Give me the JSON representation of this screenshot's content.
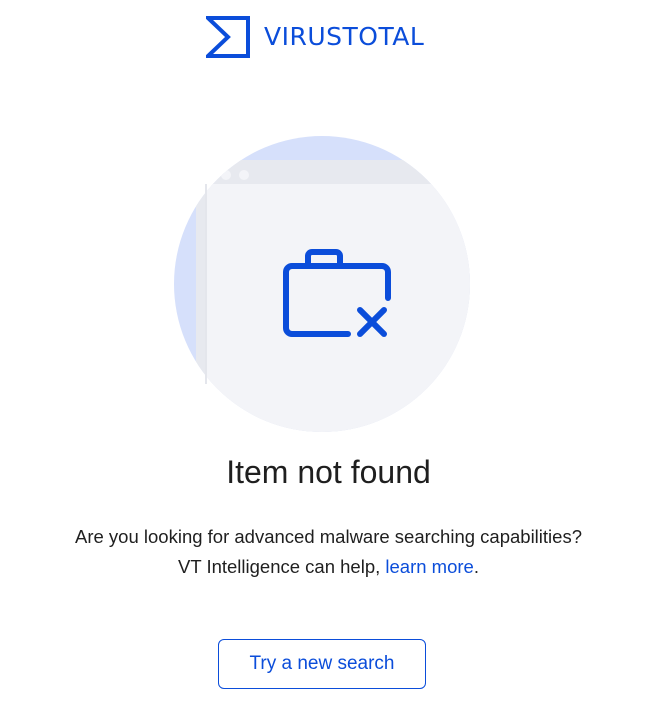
{
  "brand": {
    "name": "VIRUSTOTAL",
    "logo_icon": "virustotal-sigma-logo-icon",
    "color": "#0b4dda"
  },
  "illustration": {
    "icon": "folder-x-icon",
    "circle_color": "#f0f1f5",
    "accent_color": "#0b4dda"
  },
  "message": {
    "title": "Item not found",
    "line1": "Are you looking for advanced malware searching capabilities?",
    "line2_prefix": "VT Intelligence can help, ",
    "link_text": "learn more",
    "line2_suffix": "."
  },
  "actions": {
    "new_search_label": "Try a new search"
  }
}
